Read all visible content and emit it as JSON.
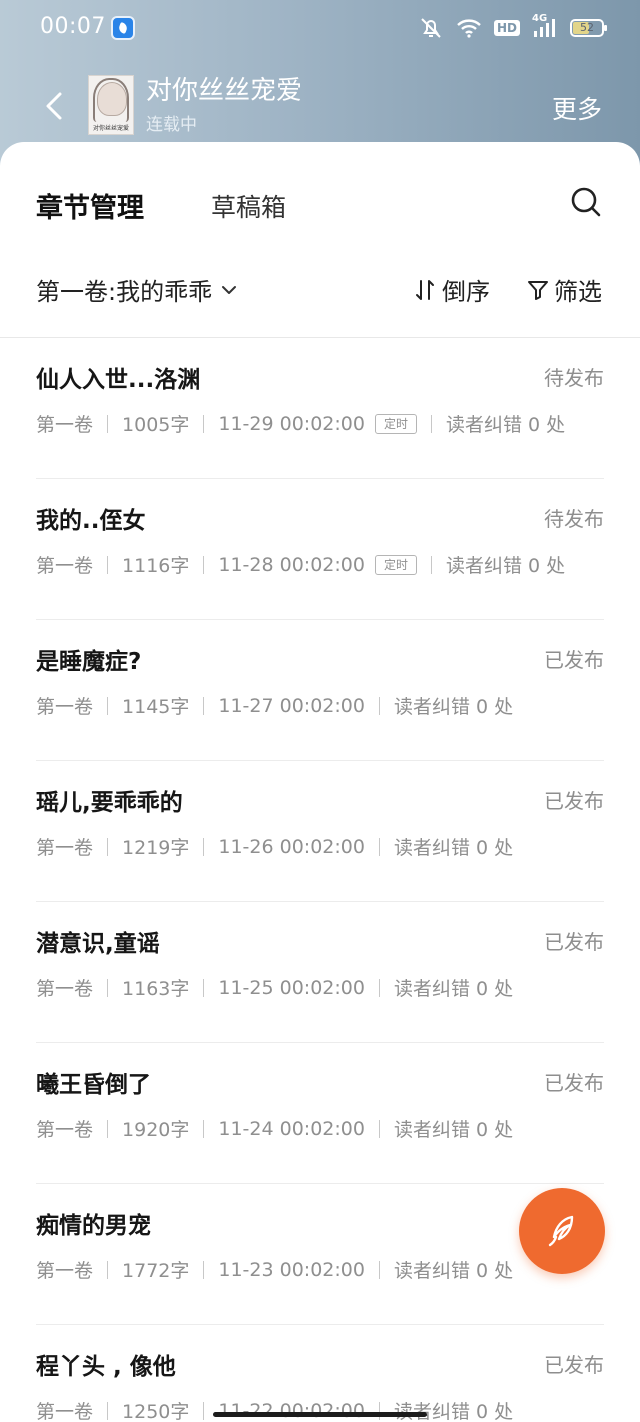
{
  "status_bar": {
    "time": "00:07",
    "network": "4G",
    "hd": "HD",
    "battery": "52"
  },
  "header": {
    "book_title": "对你丝丝宠爱",
    "book_status": "连载中",
    "more_label": "更多",
    "cover_caption": "对你丝丝宠爱"
  },
  "tabs": {
    "chapter_manage": "章节管理",
    "drafts": "草稿箱"
  },
  "toolbar": {
    "volume_label": "第一卷:我的乖乖",
    "sort_label": "倒序",
    "filter_label": "筛选"
  },
  "chapters": [
    {
      "title": "仙人入世...洛渊",
      "status": "待发布",
      "volume": "第一卷",
      "words": "1005字",
      "time": "11-29 00:02:00",
      "tag": "定时",
      "errors": "读者纠错 0 处"
    },
    {
      "title": "我的..侄女",
      "status": "待发布",
      "volume": "第一卷",
      "words": "1116字",
      "time": "11-28 00:02:00",
      "tag": "定时",
      "errors": "读者纠错 0 处"
    },
    {
      "title": "是睡魔症?",
      "status": "已发布",
      "volume": "第一卷",
      "words": "1145字",
      "time": "11-27 00:02:00",
      "tag": "",
      "errors": "读者纠错 0 处"
    },
    {
      "title": "瑶儿,要乖乖的",
      "status": "已发布",
      "volume": "第一卷",
      "words": "1219字",
      "time": "11-26 00:02:00",
      "tag": "",
      "errors": "读者纠错 0 处"
    },
    {
      "title": "潜意识,童谣",
      "status": "已发布",
      "volume": "第一卷",
      "words": "1163字",
      "time": "11-25 00:02:00",
      "tag": "",
      "errors": "读者纠错 0 处"
    },
    {
      "title": "曦王昏倒了",
      "status": "已发布",
      "volume": "第一卷",
      "words": "1920字",
      "time": "11-24 00:02:00",
      "tag": "",
      "errors": "读者纠错 0 处"
    },
    {
      "title": "痴情的男宠",
      "status": "",
      "volume": "第一卷",
      "words": "1772字",
      "time": "11-23 00:02:00",
      "tag": "",
      "errors": "读者纠错 0 处"
    },
    {
      "title": "程丫头 , 像他",
      "status": "已发布",
      "volume": "第一卷",
      "words": "1250字",
      "time": "11-22 00:02:00",
      "tag": "",
      "errors": "读者纠错 0 处"
    }
  ],
  "colors": {
    "accent": "#ef6a2f",
    "header_start": "#b9cad6",
    "header_end": "#7d97ab"
  },
  "icons": {
    "back": "chevron-left-icon",
    "search": "search-icon",
    "sort": "sort-arrows-icon",
    "filter": "funnel-icon",
    "fab": "quill-pen-icon"
  }
}
